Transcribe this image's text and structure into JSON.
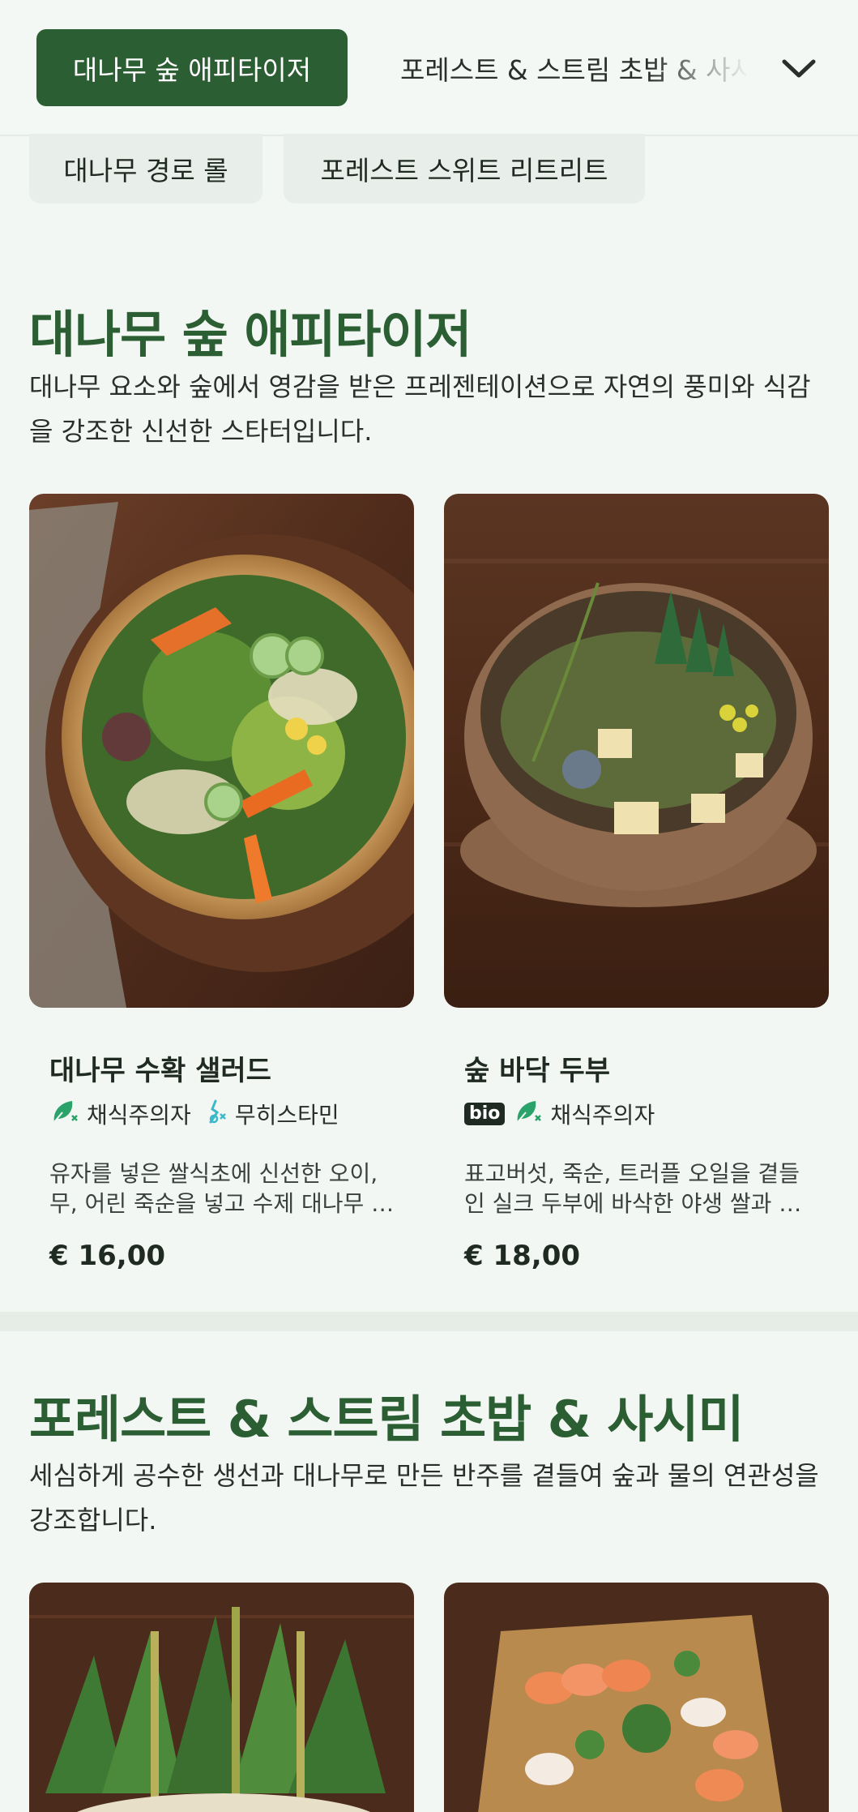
{
  "nav": {
    "active_tab": "대나무 숲 애피타이저",
    "next_tab": "포레스트 & 스트림 초밥 & 사시미",
    "sub_tabs": [
      "대나무 경로 롤",
      "포레스트 스위트 리트리트"
    ]
  },
  "sections": [
    {
      "title": "대나무 숲 애피타이저",
      "description": "대나무 요소와 숲에서 영감을 받은 프레젠테이션으로 자연의 풍미와 식감을 강조한 신선한 스타터입니다.",
      "items": [
        {
          "name": "대나무 수확 샐러드",
          "badges": [
            {
              "icon": "vegan-leaf-icon",
              "label": "채식주의자"
            },
            {
              "icon": "histamine-free-icon",
              "label": "무히스타민"
            }
          ],
          "description": "유자를 넣은 쌀식초에 신선한 오이, 무, 어린 죽순을 넣고 수제 대나무 …",
          "price": "€ 16,00"
        },
        {
          "name": "숲 바닥 두부",
          "bio_label": "bio",
          "badges": [
            {
              "icon": "vegan-leaf-icon",
              "label": "채식주의자"
            }
          ],
          "description": "표고버섯, 죽순, 트러플 오일을 곁들인 실크 두부에 바삭한 야생 쌀과 …",
          "price": "€ 18,00"
        }
      ]
    },
    {
      "title": "포레스트 & 스트림 초밥 & 사시미",
      "description": "세심하게 공수한 생선과 대나무로 만든 반주를 곁들여 숲과 물의 연관성을 강조합니다."
    }
  ],
  "colors": {
    "brand_green": "#2c5e33",
    "badge_green": "#2aa36b",
    "badge_teal": "#3bb9c9",
    "background": "#f3f7f3"
  }
}
